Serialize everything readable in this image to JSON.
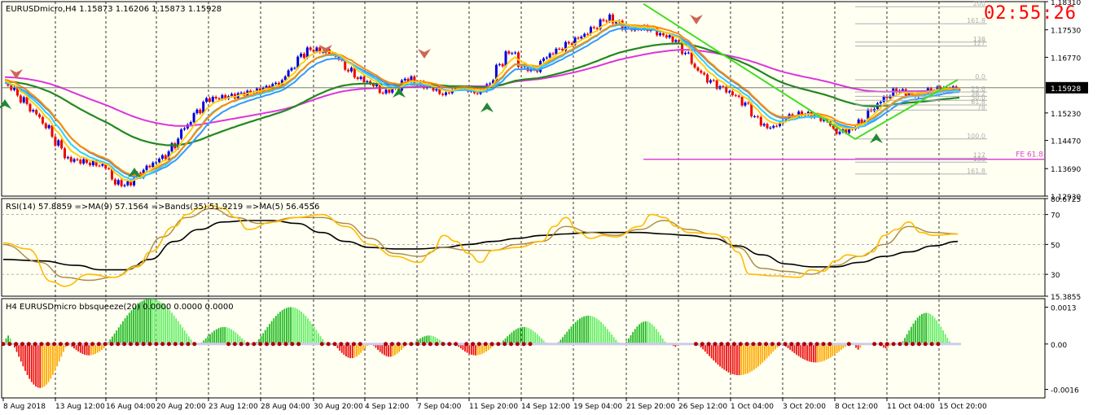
{
  "clock": "02:55:26",
  "colors": {
    "background": "#fffff2",
    "grid": "#000000",
    "bull": "#0000dd",
    "bear": "#ee0000",
    "ema_fast": "#ffcc00",
    "ema_mid": "#ff8800",
    "ma_cyan": "#33ccff",
    "ma_blue": "#3399ff",
    "ma_green": "#228822",
    "ma_magenta": "#dd33dd",
    "rsi": "#ffbb00",
    "rsi_ma": "#aa8844",
    "rsi_bands": "#000000",
    "sq_green_dark": "#22bb22",
    "sq_green_light": "#66ee66",
    "sq_red": "#ee1111",
    "sq_orange": "#ffaa00",
    "dot": "#aa0000",
    "fib": "#b0b0b0",
    "fe": "#dd44dd"
  },
  "chart_data": [
    {
      "type": "candlestick",
      "title": "EURUSDmicro,H4 1.15873 1.16206 1.15873 1.15928",
      "symbol": "EURUSDmicro",
      "timeframe": "H4",
      "ohlc_last": {
        "open": 1.15873,
        "high": 1.16206,
        "low": 1.15873,
        "close": 1.15928
      },
      "ylim": [
        1.1293,
        1.1831
      ],
      "y_ticks": [
        "1.18310",
        "1.17530",
        "1.16770",
        "1.15928",
        "1.15230",
        "1.14470",
        "1.13690",
        "1.12930"
      ],
      "y_tick_values": [
        1.1831,
        1.1753,
        1.1677,
        1.15928,
        1.1523,
        1.1447,
        1.1369,
        1.1293
      ],
      "current_price": "1.15928",
      "current_price_value": 1.15928,
      "close_path": [
        [
          0,
          1.161
        ],
        [
          3,
          1.15
        ],
        [
          5,
          1.1395
        ],
        [
          6,
          1.139
        ],
        [
          8,
          1.1375
        ],
        [
          9,
          1.132
        ],
        [
          10,
          1.133
        ],
        [
          11,
          1.1365
        ],
        [
          12,
          1.139
        ],
        [
          13,
          1.141
        ],
        [
          14,
          1.147
        ],
        [
          16,
          1.156
        ],
        [
          18,
          1.157
        ],
        [
          20,
          1.1585
        ],
        [
          21,
          1.1595
        ],
        [
          22,
          1.161
        ],
        [
          23,
          1.166
        ],
        [
          24,
          1.17
        ],
        [
          26,
          1.169
        ],
        [
          27,
          1.165
        ],
        [
          28,
          1.162
        ],
        [
          29,
          1.1605
        ],
        [
          30,
          1.158
        ],
        [
          31,
          1.159
        ],
        [
          32,
          1.162
        ],
        [
          33,
          1.16
        ],
        [
          34,
          1.159
        ],
        [
          35,
          1.157
        ],
        [
          36,
          1.16
        ],
        [
          37,
          1.158
        ],
        [
          38,
          1.158
        ],
        [
          39,
          1.164
        ],
        [
          40,
          1.17
        ],
        [
          41,
          1.165
        ],
        [
          42,
          1.164
        ],
        [
          43,
          1.168
        ],
        [
          44,
          1.17
        ],
        [
          46,
          1.174
        ],
        [
          48,
          1.179
        ],
        [
          49,
          1.176
        ],
        [
          50,
          1.1755
        ],
        [
          51,
          1.176
        ],
        [
          52,
          1.174
        ],
        [
          53,
          1.173
        ],
        [
          54,
          1.169
        ],
        [
          55,
          1.164
        ],
        [
          56,
          1.161
        ],
        [
          58,
          1.157
        ],
        [
          59,
          1.154
        ],
        [
          60,
          1.149
        ],
        [
          61,
          1.148
        ],
        [
          62,
          1.151
        ],
        [
          63,
          1.152
        ],
        [
          64,
          1.152
        ],
        [
          65,
          1.1505
        ],
        [
          66,
          1.147
        ],
        [
          67,
          1.1475
        ],
        [
          68,
          1.15
        ],
        [
          69,
          1.154
        ],
        [
          70,
          1.157
        ],
        [
          71,
          1.159
        ],
        [
          72,
          1.157
        ],
        [
          73,
          1.158
        ],
        [
          74,
          1.159
        ],
        [
          75,
          1.159
        ]
      ],
      "x_labels": [
        "8 Aug 2018",
        "13 Aug 12:00",
        "16 Aug 04:00",
        "20 Aug 20:00",
        "23 Aug 12:00",
        "28 Aug 04:00",
        "30 Aug 20:00",
        "4 Sep 12:00",
        "7 Sep 04:00",
        "11 Sep 20:00",
        "14 Sep 12:00",
        "19 Sep 04:00",
        "21 Sep 20:00",
        "26 Sep 12:00",
        "1 Oct 04:00",
        "3 Oct 20:00",
        "8 Oct 12:00",
        "11 Oct 04:00",
        "15 Oct 20:00"
      ],
      "fib_levels": [
        {
          "label": "200",
          "price": 1.1817
        },
        {
          "label": "161.8",
          "price": 1.177
        },
        {
          "label": "138",
          "price": 1.1719
        },
        {
          "label": "127",
          "price": 1.1708
        },
        {
          "label": "0.0",
          "price": 1.1615
        },
        {
          "label": "23.6",
          "price": 1.1581
        },
        {
          "label": "38.2",
          "price": 1.1569
        },
        {
          "label": "50.0",
          "price": 1.1558
        },
        {
          "label": "61.8",
          "price": 1.1545
        },
        {
          "label": "78",
          "price": 1.1531
        },
        {
          "label": "100.0",
          "price": 1.1451
        },
        {
          "label": "127",
          "price": 1.1398
        },
        {
          "label": "138",
          "price": 1.1387
        },
        {
          "label": "161.8",
          "price": 1.1354
        }
      ],
      "fe_line": {
        "label": "FE 61.8",
        "price": 1.1395
      }
    },
    {
      "type": "line",
      "title": "RSI(14) 57.8859 =>MA(9) 57.1564 =>Bands(35) 51.9219 =>MA(5) 56.4556",
      "ylim": [
        15.3855,
        80.6725
      ],
      "y_ticks": [
        "80.6725",
        "70",
        "50",
        "30",
        "15.3855"
      ],
      "y_tick_values": [
        80.6725,
        70,
        50,
        30,
        15.3855
      ],
      "levels": [
        70,
        50,
        30
      ],
      "series": [
        {
          "name": "RSI(14)",
          "values": [
            [
              0,
              51
            ],
            [
              2,
              47
            ],
            [
              4,
              25
            ],
            [
              5,
              22
            ],
            [
              7,
              30
            ],
            [
              9,
              28
            ],
            [
              11,
              35
            ],
            [
              12,
              45
            ],
            [
              14,
              62
            ],
            [
              15,
              70
            ],
            [
              16,
              74
            ],
            [
              17,
              76
            ],
            [
              18,
              74
            ],
            [
              19,
              68
            ],
            [
              20,
              60
            ],
            [
              22,
              65
            ],
            [
              24,
              68
            ],
            [
              26,
              70
            ],
            [
              28,
              62
            ],
            [
              30,
              50
            ],
            [
              32,
              42
            ],
            [
              34,
              38
            ],
            [
              35,
              45
            ],
            [
              36,
              56
            ],
            [
              37,
              52
            ],
            [
              38,
              44
            ],
            [
              39,
              38
            ],
            [
              40,
              46
            ],
            [
              42,
              48
            ],
            [
              44,
              52
            ],
            [
              45,
              62
            ],
            [
              46,
              68
            ],
            [
              47,
              58
            ],
            [
              48,
              54
            ],
            [
              49,
              56
            ],
            [
              50,
              55
            ],
            [
              52,
              62
            ],
            [
              53,
              70
            ],
            [
              54,
              68
            ],
            [
              55,
              62
            ],
            [
              56,
              58
            ],
            [
              58,
              57
            ],
            [
              59,
              55
            ],
            [
              60,
              45
            ],
            [
              61,
              30
            ],
            [
              63,
              29
            ],
            [
              65,
              28
            ],
            [
              66,
              33
            ],
            [
              67,
              32
            ],
            [
              68,
              39
            ],
            [
              69,
              43
            ],
            [
              70,
              42
            ],
            [
              71,
              45
            ],
            [
              72,
              56
            ],
            [
              73,
              60
            ],
            [
              74,
              65
            ],
            [
              75,
              58
            ],
            [
              76,
              56
            ],
            [
              78,
              57
            ]
          ]
        },
        {
          "name": "MA(9)",
          "values": [
            [
              0,
              50
            ],
            [
              3,
              38
            ],
            [
              5,
              28
            ],
            [
              7,
              26
            ],
            [
              9,
              28
            ],
            [
              11,
              36
            ],
            [
              13,
              55
            ],
            [
              15,
              68
            ],
            [
              17,
              74
            ],
            [
              19,
              68
            ],
            [
              21,
              64
            ],
            [
              24,
              68
            ],
            [
              26,
              68
            ],
            [
              28,
              64
            ],
            [
              30,
              54
            ],
            [
              32,
              44
            ],
            [
              34,
              42
            ],
            [
              36,
              48
            ],
            [
              38,
              46
            ],
            [
              40,
              46
            ],
            [
              42,
              50
            ],
            [
              44,
              52
            ],
            [
              46,
              62
            ],
            [
              48,
              58
            ],
            [
              50,
              56
            ],
            [
              52,
              60
            ],
            [
              54,
              66
            ],
            [
              56,
              60
            ],
            [
              58,
              57
            ],
            [
              60,
              48
            ],
            [
              62,
              34
            ],
            [
              64,
              32
            ],
            [
              66,
              30
            ],
            [
              68,
              36
            ],
            [
              70,
              42
            ],
            [
              72,
              50
            ],
            [
              74,
              62
            ],
            [
              76,
              58
            ],
            [
              78,
              57
            ]
          ]
        },
        {
          "name": "Bands(35)",
          "values": [
            [
              0,
              40
            ],
            [
              3,
              39
            ],
            [
              6,
              36
            ],
            [
              8,
              33
            ],
            [
              10,
              33
            ],
            [
              12,
              40
            ],
            [
              14,
              52
            ],
            [
              16,
              60
            ],
            [
              18,
              65
            ],
            [
              20,
              66
            ],
            [
              22,
              66
            ],
            [
              24,
              64
            ],
            [
              26,
              58
            ],
            [
              28,
              52
            ],
            [
              30,
              48
            ],
            [
              32,
              47
            ],
            [
              34,
              47
            ],
            [
              36,
              48
            ],
            [
              38,
              50
            ],
            [
              40,
              52
            ],
            [
              42,
              54
            ],
            [
              44,
              56
            ],
            [
              46,
              57
            ],
            [
              48,
              58
            ],
            [
              50,
              58
            ],
            [
              52,
              58
            ],
            [
              54,
              57
            ],
            [
              56,
              56
            ],
            [
              58,
              54
            ],
            [
              60,
              49
            ],
            [
              62,
              43
            ],
            [
              64,
              37
            ],
            [
              66,
              35
            ],
            [
              68,
              35
            ],
            [
              70,
              38
            ],
            [
              72,
              42
            ],
            [
              74,
              45
            ],
            [
              76,
              49
            ],
            [
              78,
              52
            ]
          ]
        }
      ]
    },
    {
      "type": "bar",
      "title": "H4 EURUSDmicro bbsqueeze(20) 0.0000 0.0000 0.0000",
      "ylim": [
        -0.0019,
        0.0016
      ],
      "y_ticks": [
        "0.0013",
        "0.00",
        "-0.0016"
      ],
      "y_tick_values": [
        0.0013,
        0.0,
        -0.0016
      ],
      "waves": [
        {
          "start": 0,
          "end": 4,
          "peak": 0.0003
        },
        {
          "start": 4,
          "end": 30,
          "peak": -0.00155
        },
        {
          "start": 30,
          "end": 50,
          "peak": -0.0004
        },
        {
          "start": 48,
          "end": 90,
          "peak": 0.0016
        },
        {
          "start": 92,
          "end": 115,
          "peak": 0.0006
        },
        {
          "start": 118,
          "end": 152,
          "peak": 0.0013
        },
        {
          "start": 155,
          "end": 172,
          "peak": -0.0005
        },
        {
          "start": 173,
          "end": 190,
          "peak": -0.00045
        },
        {
          "start": 192,
          "end": 208,
          "peak": 0.0003
        },
        {
          "start": 212,
          "end": 232,
          "peak": -0.0004
        },
        {
          "start": 233,
          "end": 256,
          "peak": 0.0006
        },
        {
          "start": 260,
          "end": 290,
          "peak": 0.001
        },
        {
          "start": 292,
          "end": 312,
          "peak": 0.0008
        },
        {
          "start": 314,
          "end": 318,
          "peak": -0.0001
        },
        {
          "start": 326,
          "end": 366,
          "peak": -0.0011
        },
        {
          "start": 366,
          "end": 398,
          "peak": -0.00065
        },
        {
          "start": 400,
          "end": 404,
          "peak": -0.0002
        },
        {
          "start": 412,
          "end": 418,
          "peak": -0.00015
        },
        {
          "start": 422,
          "end": 446,
          "peak": 0.0011
        }
      ]
    }
  ]
}
